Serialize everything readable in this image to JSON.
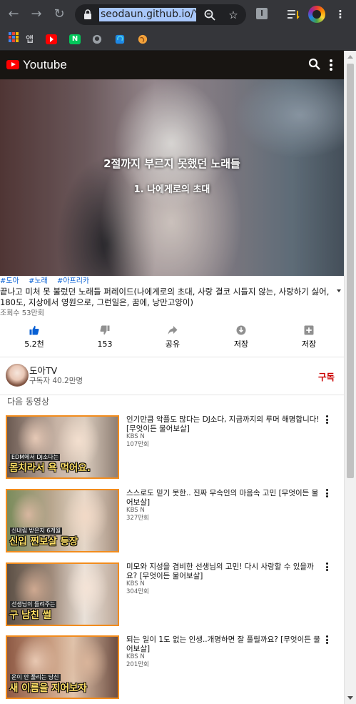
{
  "browser": {
    "url": "seodaun.github.io/Yo",
    "bookmarks_label": "앱",
    "icons": [
      "back-arrow-icon",
      "forward-arrow-icon",
      "reload-icon",
      "lock-icon",
      "zoom-icon",
      "star-icon",
      "reading-list-icon",
      "profile-avatar-icon",
      "kebab-menu-icon"
    ]
  },
  "header": {
    "title": "Youtube",
    "accent": "#ff0000"
  },
  "video": {
    "caption_line1": "2절까지 부르지 못했던 노래들",
    "caption_line2": "1. 나에게로의 초대",
    "tags": [
      "#도아",
      "#노래",
      "#아프리카"
    ],
    "title": "끝나고 미처 못 불렀던 노래들 퍼레이드(나에게로의 초대, 사랑 결코 시들지 않는, 사랑하기 싫어, 180도, 지상에서 영원으로, 그런일은, 꿈에, 낭만고양이)",
    "views": "조회수 53만회"
  },
  "actions": {
    "like": "5.2천",
    "dislike": "153",
    "share": "공유",
    "save": "저장",
    "save2": "저장"
  },
  "channel": {
    "name": "도아TV",
    "subscribers": "구독자 40.2만명",
    "subscribe_label": "구독"
  },
  "next_label": "다음 동영상",
  "recommendations": [
    {
      "title": "인기만큼 악플도 많다는 DJ소다, 지금까지의 루머 해명합니다! [무엇이든 물어보살]",
      "channel": "KBS N",
      "views": "107만회",
      "thumb_small": "EDM에서 DJ소다는",
      "thumb_big": "몸치라서 욕 먹어요."
    },
    {
      "title": "스스로도 믿기 못한.. 진짜 무속인의 마음속 고민 [무엇이든 물어보살]",
      "channel": "KBS N",
      "views": "327만회",
      "thumb_small": "신내림 받은지 6개월",
      "thumb_big": "신입 찐보살 등장"
    },
    {
      "title": "미모와 지성을 겸비한 선생님의 고민! 다시 사랑할 수 있을까요? [무엇이든 물어보살]",
      "channel": "KBS N",
      "views": "304만회",
      "thumb_small": "선생님이 들려주는",
      "thumb_big": "구 남친 썰"
    },
    {
      "title": "되는 일이 1도 없는 인생..개명하면 잘 풀릴까요? [무엇이든 물어보살]",
      "channel": "KBS N",
      "views": "201만회",
      "thumb_small": "운이 안 풀리는 당신",
      "thumb_big": "새 이름을 지어보자"
    }
  ]
}
